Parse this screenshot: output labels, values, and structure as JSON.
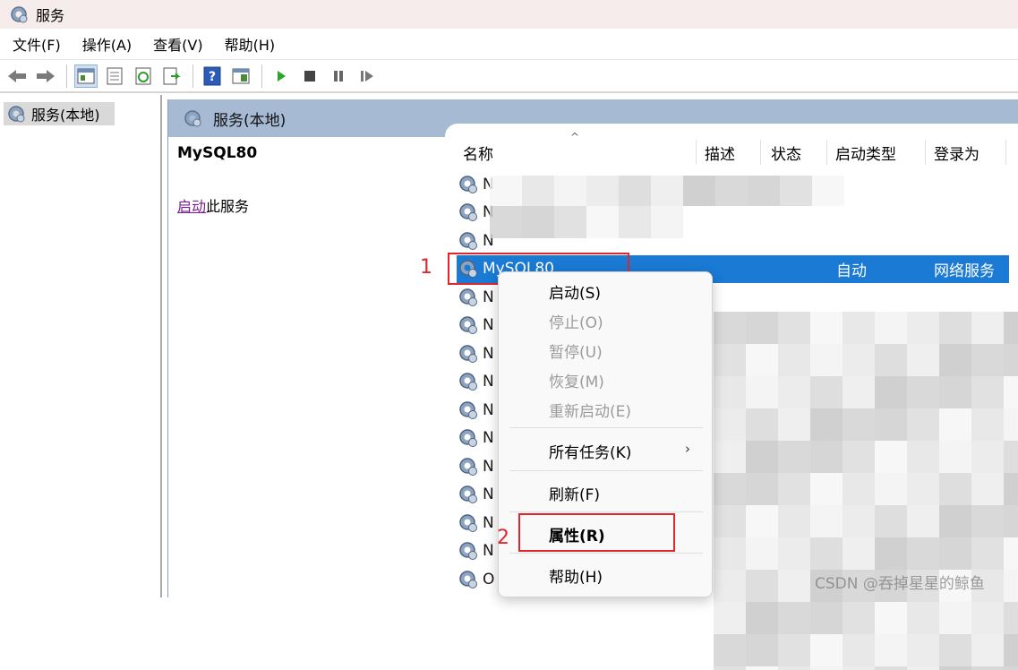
{
  "window": {
    "title": "服务"
  },
  "menu": [
    "文件(F)",
    "操作(A)",
    "查看(V)",
    "帮助(H)"
  ],
  "tree": {
    "node_label": "服务(本地)"
  },
  "main": {
    "header_label": "服务(本地)",
    "selected_service": "MySQL80",
    "start_link": "启动",
    "start_suffix": "此服务"
  },
  "list": {
    "columns": [
      "名称",
      "描述",
      "状态",
      "启动类型",
      "登录为"
    ],
    "rows": [
      {
        "name": "N"
      },
      {
        "name": "N"
      },
      {
        "name": "N"
      },
      {
        "name": "MySQL80",
        "startup": "自动",
        "logon": "网络服务",
        "selected": true
      },
      {
        "name": "N"
      },
      {
        "name": "N"
      },
      {
        "name": "N"
      },
      {
        "name": "N"
      },
      {
        "name": "N"
      },
      {
        "name": "N"
      },
      {
        "name": "N"
      },
      {
        "name": "N"
      },
      {
        "name": "N"
      },
      {
        "name": "N"
      },
      {
        "name": "O"
      }
    ]
  },
  "context_menu": {
    "items": [
      {
        "label": "启动(S)",
        "enabled": true
      },
      {
        "label": "停止(O)",
        "enabled": false
      },
      {
        "label": "暂停(U)",
        "enabled": false
      },
      {
        "label": "恢复(M)",
        "enabled": false
      },
      {
        "label": "重新启动(E)",
        "enabled": false
      },
      {
        "label": "所有任务(K)",
        "enabled": true,
        "submenu": true
      },
      {
        "label": "刷新(F)",
        "enabled": true
      },
      {
        "label": "属性(R)",
        "enabled": true,
        "bold": true
      },
      {
        "label": "帮助(H)",
        "enabled": true
      }
    ]
  },
  "annotations": {
    "label_1": "1",
    "label_2": "2",
    "color": "#e0262d"
  },
  "watermark": "CSDN @吞掉星星的鲸鱼",
  "colors": {
    "selection": "#1a7ad4",
    "header": "#a6bad4",
    "link": "#7a1f8f"
  }
}
